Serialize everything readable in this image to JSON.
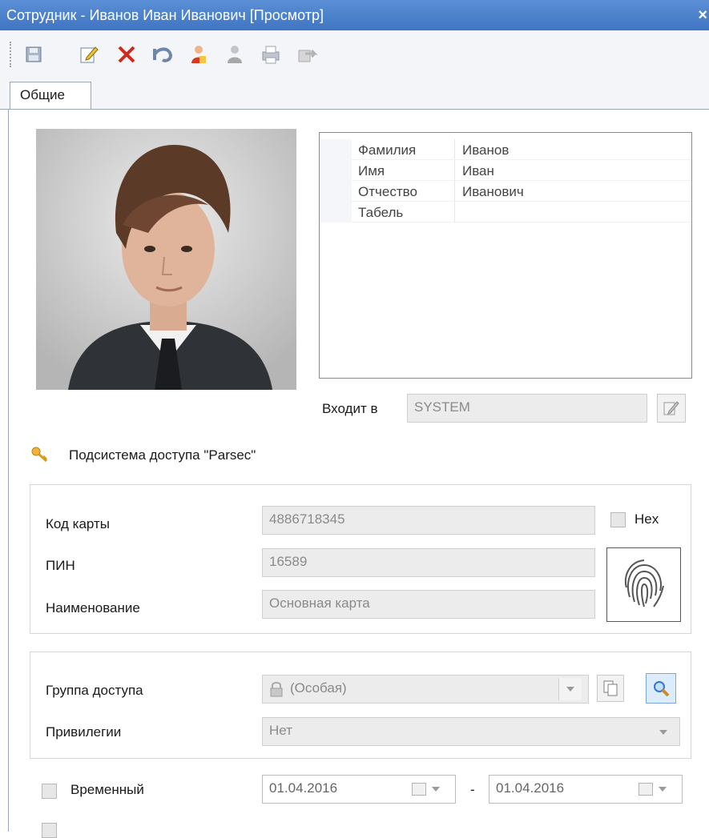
{
  "window": {
    "title": "Сотрудник - Иванов Иван Иванович [Просмотр]",
    "close_glyph": "×"
  },
  "toolbar": {
    "icons": [
      "save-icon",
      "edit-icon",
      "delete-icon",
      "undo-icon",
      "person-red-icon",
      "person-gray-icon",
      "print-icon",
      "export-icon"
    ]
  },
  "tabs": {
    "general": "Общие"
  },
  "name_grid": {
    "rows": [
      {
        "label": "Фамилия",
        "value": "Иванов"
      },
      {
        "label": "Имя",
        "value": "Иван"
      },
      {
        "label": "Отчество",
        "value": "Иванович"
      },
      {
        "label": "Табель",
        "value": ""
      }
    ]
  },
  "membership": {
    "label": "Входит в",
    "value": "SYSTEM"
  },
  "subsystem": {
    "title": "Подсистема доступа \"Parsec\""
  },
  "card": {
    "code_label": "Код карты",
    "code_value": "4886718345",
    "hex_label": "Hex",
    "pin_label": "ПИН",
    "pin_value": "16589",
    "name_label": "Наименование",
    "name_value": "Основная карта"
  },
  "access": {
    "group_label": "Группа доступа",
    "group_value": "(Особая)",
    "priv_label": "Привилегии",
    "priv_value": "Нет"
  },
  "temporary": {
    "label": "Временный",
    "date_from": "01.04.2016",
    "dash": "-",
    "date_to": "01.04.2016"
  },
  "colors": {
    "titlebar": "#4a80c9",
    "accent_icon": "#d02a1f"
  }
}
